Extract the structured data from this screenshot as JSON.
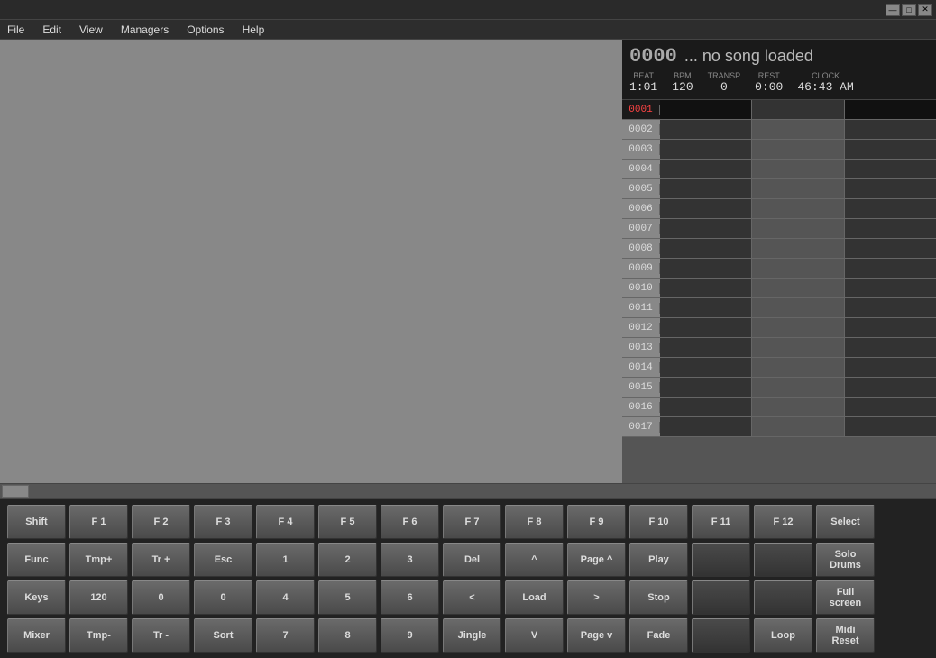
{
  "titlebar": {
    "minimize": "—",
    "maximize": "□",
    "close": "✕"
  },
  "menubar": {
    "items": [
      "File",
      "Edit",
      "View",
      "Managers",
      "Options",
      "Help"
    ]
  },
  "song_display": {
    "number": "0000",
    "name": "... no song loaded",
    "stats": {
      "beat_label": "BEAT",
      "beat_value": "1:01",
      "bpm_label": "BPM",
      "bpm_value": "120",
      "transp_label": "TRANSP",
      "transp_value": "0",
      "rest_label": "REST",
      "rest_value": "0:00",
      "clock_label": "CLOCK",
      "clock_value": "46:43 AM"
    }
  },
  "song_list": {
    "rows": [
      {
        "num": "0001",
        "selected": true
      },
      {
        "num": "0002",
        "selected": false
      },
      {
        "num": "0003",
        "selected": false
      },
      {
        "num": "0004",
        "selected": false
      },
      {
        "num": "0005",
        "selected": false
      },
      {
        "num": "0006",
        "selected": false
      },
      {
        "num": "0007",
        "selected": false
      },
      {
        "num": "0008",
        "selected": false
      },
      {
        "num": "0009",
        "selected": false
      },
      {
        "num": "0010",
        "selected": false
      },
      {
        "num": "0011",
        "selected": false
      },
      {
        "num": "0012",
        "selected": false
      },
      {
        "num": "0013",
        "selected": false
      },
      {
        "num": "0014",
        "selected": false
      },
      {
        "num": "0015",
        "selected": false
      },
      {
        "num": "0016",
        "selected": false
      },
      {
        "num": "0017",
        "selected": false
      }
    ]
  },
  "keyboard": {
    "row1": {
      "keys": [
        {
          "label": "Shift",
          "name": "shift-key"
        },
        {
          "label": "F 1",
          "name": "f1-key"
        },
        {
          "label": "F 2",
          "name": "f2-key"
        },
        {
          "label": "F 3",
          "name": "f3-key"
        },
        {
          "label": "F 4",
          "name": "f4-key"
        },
        {
          "label": "F 5",
          "name": "f5-key"
        },
        {
          "label": "F 6",
          "name": "f6-key"
        },
        {
          "label": "F 7",
          "name": "f7-key"
        },
        {
          "label": "F 8",
          "name": "f8-key"
        },
        {
          "label": "F 9",
          "name": "f9-key"
        },
        {
          "label": "F 10",
          "name": "f10-key"
        },
        {
          "label": "F 11",
          "name": "f11-key"
        },
        {
          "label": "F 12",
          "name": "f12-key"
        },
        {
          "label": "Select",
          "name": "select-key"
        }
      ]
    },
    "row2": {
      "keys": [
        {
          "label": "Func",
          "name": "func-key"
        },
        {
          "label": "Tmp+",
          "name": "tmp-plus-key"
        },
        {
          "label": "Tr +",
          "name": "tr-plus-key"
        },
        {
          "label": "Esc",
          "name": "esc-key"
        },
        {
          "label": "1",
          "name": "key-1"
        },
        {
          "label": "2",
          "name": "key-2"
        },
        {
          "label": "3",
          "name": "key-3"
        },
        {
          "label": "Del",
          "name": "del-key"
        },
        {
          "label": "^",
          "name": "caret-key"
        },
        {
          "label": "Page ^",
          "name": "page-up-key"
        },
        {
          "label": "Play",
          "name": "play-key"
        },
        {
          "label": "",
          "name": "empty-key-r2-11",
          "dark": true
        },
        {
          "label": "",
          "name": "empty-key-r2-12",
          "dark": true
        },
        {
          "label": "Solo\nDrums",
          "name": "solo-drums-key"
        }
      ]
    },
    "row3": {
      "keys": [
        {
          "label": "Keys",
          "name": "keys-key"
        },
        {
          "label": "120",
          "name": "120-key"
        },
        {
          "label": "0",
          "name": "key-0-1"
        },
        {
          "label": "0",
          "name": "key-0-2"
        },
        {
          "label": "4",
          "name": "key-4"
        },
        {
          "label": "5",
          "name": "key-5"
        },
        {
          "label": "6",
          "name": "key-6"
        },
        {
          "label": "<",
          "name": "lt-key"
        },
        {
          "label": "Load",
          "name": "load-key"
        },
        {
          "label": ">",
          "name": "gt-key"
        },
        {
          "label": "Stop",
          "name": "stop-key"
        },
        {
          "label": "",
          "name": "empty-key-r3-11",
          "dark": true
        },
        {
          "label": "",
          "name": "empty-key-r3-12",
          "dark": true
        },
        {
          "label": "Full\nscreen",
          "name": "fullscreen-key"
        }
      ]
    },
    "row4": {
      "keys": [
        {
          "label": "Mixer",
          "name": "mixer-key"
        },
        {
          "label": "Tmp-",
          "name": "tmp-minus-key"
        },
        {
          "label": "Tr -",
          "name": "tr-minus-key"
        },
        {
          "label": "Sort",
          "name": "sort-key"
        },
        {
          "label": "7",
          "name": "key-7"
        },
        {
          "label": "8",
          "name": "key-8"
        },
        {
          "label": "9",
          "name": "key-9"
        },
        {
          "label": "Jingle",
          "name": "jingle-key"
        },
        {
          "label": "V",
          "name": "v-key"
        },
        {
          "label": "Page v",
          "name": "page-down-key"
        },
        {
          "label": "Fade",
          "name": "fade-key"
        },
        {
          "label": "",
          "name": "empty-key-r4-11",
          "dark": true
        },
        {
          "label": "Loop",
          "name": "loop-key"
        },
        {
          "label": "Midi\nReset",
          "name": "midi-reset-key"
        }
      ]
    }
  }
}
